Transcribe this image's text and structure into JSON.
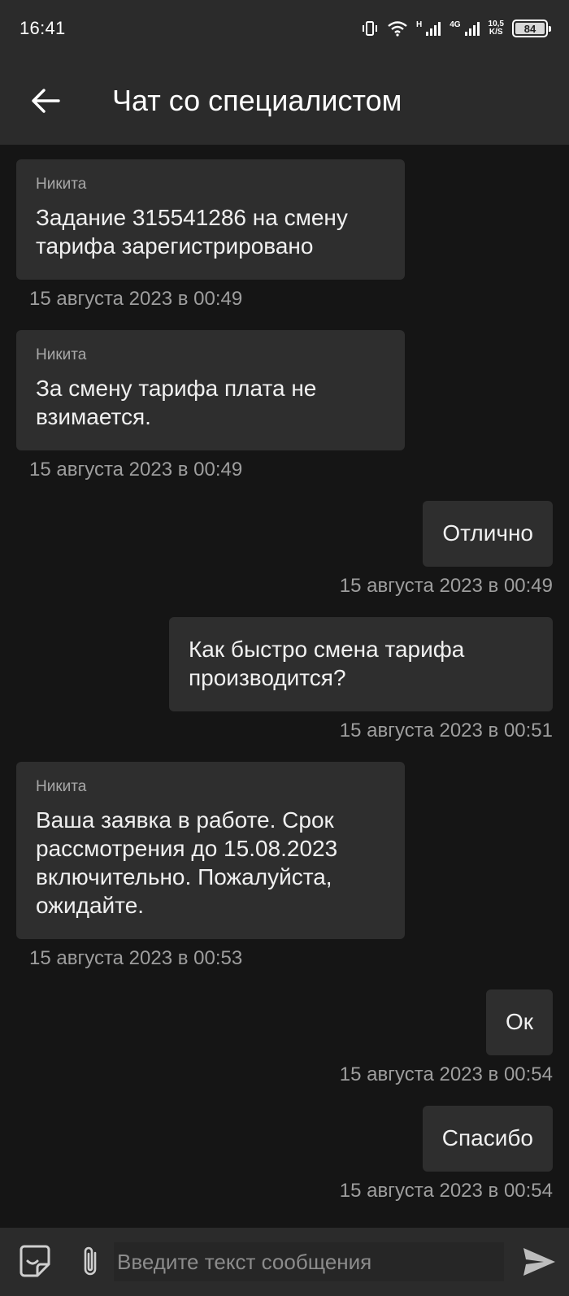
{
  "status_bar": {
    "time": "16:41",
    "signal1_label": "H",
    "signal2_label": "4G",
    "net_speed_value": "10,5",
    "net_speed_unit": "K/S",
    "battery_level": "84"
  },
  "header": {
    "title": "Чат со специалистом"
  },
  "messages": [
    {
      "direction": "incoming",
      "sender": "Никита",
      "text": "Задание 315541286 на смену тарифа зарегистрировано",
      "time": "15 августа 2023 в 00:49"
    },
    {
      "direction": "incoming",
      "sender": "Никита",
      "text": "За смену тарифа плата не взимается.",
      "time": "15 августа 2023 в 00:49"
    },
    {
      "direction": "outgoing",
      "text": "Отлично",
      "time": "15 августа 2023 в 00:49"
    },
    {
      "direction": "outgoing",
      "text": "Как быстро смена тарифа производится?",
      "time": "15 августа 2023 в 00:51"
    },
    {
      "direction": "incoming",
      "sender": "Никита",
      "text": "Ваша заявка в работе. Срок рассмотрения до 15.08.2023 включительно. Пожалуйста, ожидайте.",
      "time": "15 августа 2023 в 00:53"
    },
    {
      "direction": "outgoing",
      "text": "Ок",
      "time": "15 августа 2023 в 00:54"
    },
    {
      "direction": "outgoing",
      "text": "Спасибо",
      "time": "15 августа 2023 в 00:54"
    }
  ],
  "input": {
    "placeholder": "Введите текст сообщения",
    "value": ""
  },
  "icons": {
    "back": "arrow-left-icon",
    "sticker": "sticker-icon",
    "attach": "paperclip-icon",
    "send": "send-icon"
  },
  "colors": {
    "background": "#151515",
    "bar": "#2b2b2b",
    "bubble": "#2e2e2e",
    "time_text": "#9e9e9e"
  }
}
